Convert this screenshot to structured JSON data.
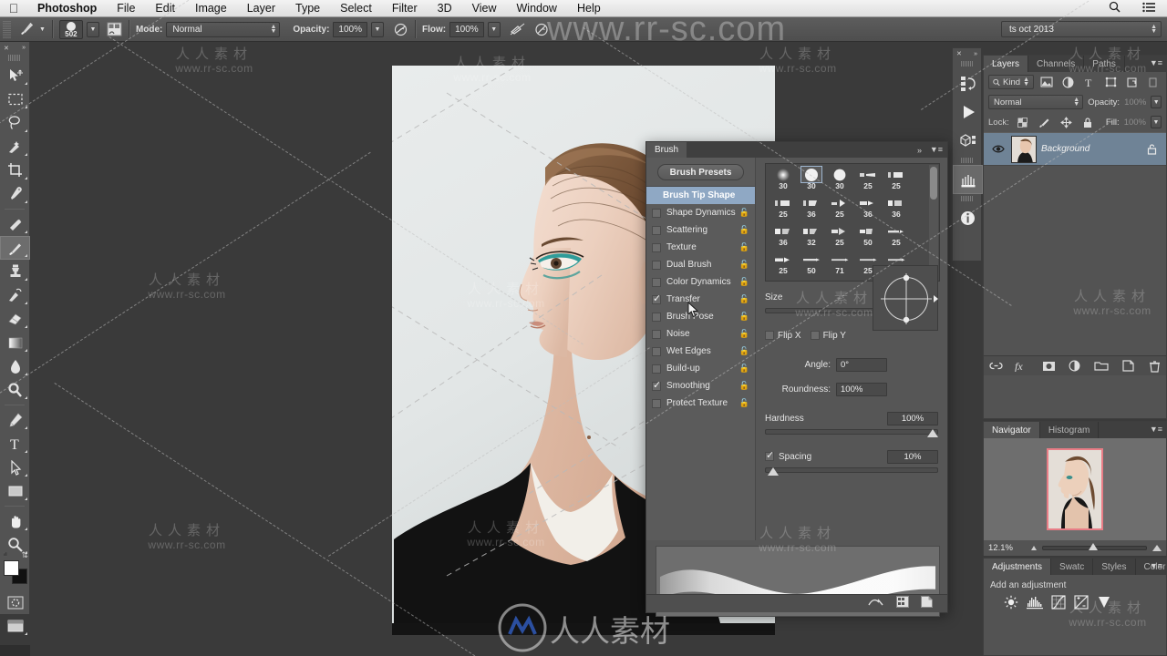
{
  "menubar": {
    "apple_icon": "apple-logo-icon",
    "items": [
      "Photoshop",
      "File",
      "Edit",
      "Image",
      "Layer",
      "Type",
      "Select",
      "Filter",
      "3D",
      "View",
      "Window",
      "Help"
    ],
    "right_icons": [
      "search-icon",
      "list-menu-icon"
    ]
  },
  "options_bar": {
    "tool_icon": "brush-tool-icon",
    "brush_size_label": "502",
    "toggle_panel_icon": "toggle-brush-panel-icon",
    "mode_label": "Mode:",
    "mode_value": "Normal",
    "opacity_label": "Opacity:",
    "opacity_value": "100%",
    "airbrush_icon": "airbrush-icon",
    "flow_label": "Flow:",
    "flow_value": "100%",
    "tablet_pressure_size_icon": "pressure-size-icon",
    "tablet_pressure_opacity_icon": "pressure-opacity-icon",
    "preset_value": "ts oct 2013"
  },
  "toolbar": {
    "close_icon": "close-icon",
    "expand_icon": "expand-collapse-icon",
    "tools": [
      {
        "name": "move-tool",
        "icon": "move-tool-icon"
      },
      {
        "name": "rectangular-marquee-tool",
        "icon": "marquee-tool-icon"
      },
      {
        "name": "lasso-tool",
        "icon": "lasso-tool-icon"
      },
      {
        "name": "quick-selection-tool",
        "icon": "quick-selection-icon"
      },
      {
        "name": "crop-tool",
        "icon": "crop-tool-icon"
      },
      {
        "name": "eyedropper-tool",
        "icon": "eyedropper-icon"
      },
      {
        "name": "spot-healing-brush-tool",
        "icon": "healing-brush-icon"
      },
      {
        "name": "brush-tool",
        "icon": "brush-tool-icon"
      },
      {
        "name": "clone-stamp-tool",
        "icon": "clone-stamp-icon"
      },
      {
        "name": "history-brush-tool",
        "icon": "history-brush-icon"
      },
      {
        "name": "eraser-tool",
        "icon": "eraser-icon"
      },
      {
        "name": "gradient-tool",
        "icon": "gradient-icon"
      },
      {
        "name": "blur-tool",
        "icon": "blur-drop-icon"
      },
      {
        "name": "dodge-tool",
        "icon": "dodge-icon"
      },
      {
        "name": "pen-tool",
        "icon": "pen-tool-icon"
      },
      {
        "name": "type-tool",
        "icon": "type-tool-icon"
      },
      {
        "name": "path-selection-tool",
        "icon": "path-selection-icon"
      },
      {
        "name": "rectangle-tool",
        "icon": "rectangle-shape-icon"
      },
      {
        "name": "hand-tool",
        "icon": "hand-tool-icon"
      },
      {
        "name": "zoom-tool",
        "icon": "zoom-tool-icon"
      }
    ],
    "active_tool": "brush-tool",
    "swap_colors_icon": "swap-colors-icon",
    "default_colors_icon": "default-colors-icon",
    "foreground_color": "#ffffff",
    "background_color": "#111111",
    "quickmask_icon": "quick-mask-icon",
    "screenmode_icon": "screen-mode-icon"
  },
  "icon_dock": {
    "items": [
      {
        "name": "history-panel-icon",
        "icon": "history-icon"
      },
      {
        "name": "actions-panel-icon",
        "icon": "play-triangle-icon"
      },
      {
        "name": "3d-panel-icon",
        "icon": "cube-icon"
      },
      {
        "name": "brush-presets-panel-icon",
        "icon": "brush-bristle-icon"
      },
      {
        "name": "info-panel-icon",
        "icon": "info-circle-icon"
      }
    ],
    "active": "brush-presets-panel-icon"
  },
  "brush_panel": {
    "title": "Brush",
    "collapse_icon": "collapse-double-arrow-icon",
    "menu_icon": "panel-menu-icon",
    "presets_button": "Brush Presets",
    "options": [
      {
        "label": "Brush Tip Shape",
        "checked": null,
        "selected": true,
        "locked": false
      },
      {
        "label": "Shape Dynamics",
        "checked": false,
        "selected": false,
        "locked": true
      },
      {
        "label": "Scattering",
        "checked": false,
        "selected": false,
        "locked": true
      },
      {
        "label": "Texture",
        "checked": false,
        "selected": false,
        "locked": true
      },
      {
        "label": "Dual Brush",
        "checked": false,
        "selected": false,
        "locked": true
      },
      {
        "label": "Color Dynamics",
        "checked": false,
        "selected": false,
        "locked": true
      },
      {
        "label": "Transfer",
        "checked": true,
        "selected": false,
        "locked": true
      },
      {
        "label": "Brush Pose",
        "checked": false,
        "selected": false,
        "locked": true
      },
      {
        "label": "Noise",
        "checked": false,
        "selected": false,
        "locked": true
      },
      {
        "label": "Wet Edges",
        "checked": false,
        "selected": false,
        "locked": true
      },
      {
        "label": "Build-up",
        "checked": false,
        "selected": false,
        "locked": true
      },
      {
        "label": "Smoothing",
        "checked": true,
        "selected": false,
        "locked": true
      },
      {
        "label": "Protect Texture",
        "checked": false,
        "selected": false,
        "locked": true
      }
    ],
    "brush_grid": [
      {
        "size": "30",
        "tip": "soft-round",
        "selected": false
      },
      {
        "size": "30",
        "tip": "hard-round",
        "selected": true
      },
      {
        "size": "30",
        "tip": "round",
        "selected": false
      },
      {
        "size": "25",
        "tip": "flat-angle",
        "selected": false
      },
      {
        "size": "25",
        "tip": "flat-block",
        "selected": false
      },
      {
        "size": "25",
        "tip": "flat-block",
        "selected": false
      },
      {
        "size": "36",
        "tip": "flat-fan",
        "selected": false
      },
      {
        "size": "25",
        "tip": "round-fan",
        "selected": false
      },
      {
        "size": "36",
        "tip": "point-round",
        "selected": false
      },
      {
        "size": "36",
        "tip": "square-block",
        "selected": false
      },
      {
        "size": "36",
        "tip": "flat-square",
        "selected": false
      },
      {
        "size": "32",
        "tip": "angle-block",
        "selected": false
      },
      {
        "size": "25",
        "tip": "round-blunt",
        "selected": false
      },
      {
        "size": "50",
        "tip": "flat-taper",
        "selected": false
      },
      {
        "size": "25",
        "tip": "thin-taper",
        "selected": false
      },
      {
        "size": "25",
        "tip": "round-point",
        "selected": false
      },
      {
        "size": "50",
        "tip": "flat-line",
        "selected": false
      },
      {
        "size": "71",
        "tip": "thin-line",
        "selected": false
      },
      {
        "size": "25",
        "tip": "thin-line",
        "selected": false
      },
      {
        "size": "50",
        "tip": "thin-line",
        "selected": false
      },
      {
        "size": "",
        "tip": "thin-line",
        "selected": false
      },
      {
        "size": "",
        "tip": "thin-line",
        "selected": false
      },
      {
        "size": "",
        "tip": "thin-line",
        "selected": false
      },
      {
        "size": "",
        "tip": "block",
        "selected": false
      },
      {
        "size": "",
        "tip": "thin-line",
        "selected": false
      }
    ],
    "size_label": "Size",
    "size_value": "502 px",
    "flip_x_label": "Flip X",
    "flip_x_checked": false,
    "flip_y_label": "Flip Y",
    "flip_y_checked": false,
    "angle_label": "Angle:",
    "angle_value": "0°",
    "roundness_label": "Roundness:",
    "roundness_value": "100%",
    "hardness_label": "Hardness",
    "hardness_value": "100%",
    "spacing_label": "Spacing",
    "spacing_checked": true,
    "spacing_value": "10%",
    "footer_icons": [
      "toggle-brush-preview-icon",
      "brush-presets-grid-icon",
      "new-brush-icon"
    ]
  },
  "layers_panel": {
    "tabs": [
      "Layers",
      "Channels",
      "Paths"
    ],
    "active_tab": "Layers",
    "menu_icon": "panel-menu-icon",
    "filter_kind_label": "Kind",
    "filter_icons": [
      "filter-pixel-icon",
      "filter-adjustment-icon",
      "filter-type-icon",
      "filter-shape-icon",
      "filter-smart-object-icon"
    ],
    "filter_toggle_icon": "filter-power-icon",
    "blend_mode": "Normal",
    "opacity_label": "Opacity:",
    "opacity_value": "100%",
    "lock_label": "Lock:",
    "lock_icons": [
      "lock-transparency-icon",
      "lock-image-icon",
      "lock-position-icon",
      "lock-all-icon"
    ],
    "fill_label": "Fill:",
    "fill_value": "100%",
    "layers": [
      {
        "name": "Background",
        "visible": true,
        "locked": true,
        "thumb": "portrait-thumb"
      }
    ],
    "footer_icons": [
      "link-layers-icon",
      "layer-style-fx-icon",
      "add-mask-icon",
      "new-adjustment-layer-icon",
      "new-group-icon",
      "new-layer-icon",
      "delete-layer-icon"
    ]
  },
  "navigator_panel": {
    "tabs": [
      "Navigator",
      "Histogram"
    ],
    "active_tab": "Navigator",
    "menu_icon": "panel-menu-icon",
    "zoom_value": "12.1%",
    "zoom_out_icon": "zoom-out-icon",
    "zoom_in_icon": "zoom-in-icon"
  },
  "adjustments_panel": {
    "tabs": [
      "Adjustments",
      "Swatc",
      "Styles",
      "Color"
    ],
    "active_tab": "Adjustments",
    "menu_icon": "panel-menu-icon",
    "title": "Add an adjustment",
    "icons": [
      "brightness-contrast-icon",
      "levels-icon",
      "curves-icon",
      "exposure-icon",
      "vibrance-icon"
    ]
  },
  "canvas": {
    "document_title": "",
    "cursor_icon": "arrow-cursor-icon"
  },
  "watermarks": {
    "site_big": "www.rr-sc.com",
    "site": "www.rr-sc.com",
    "cn": "人人素材"
  },
  "colors": {
    "panel_bg": "#535353",
    "panel_dark": "#3f3f3f",
    "accent_selected": "#8fa8c4",
    "layer_selected": "#6f8396",
    "navigator_frame": "#e87d86",
    "menubar_bg": "#eeeeee"
  }
}
